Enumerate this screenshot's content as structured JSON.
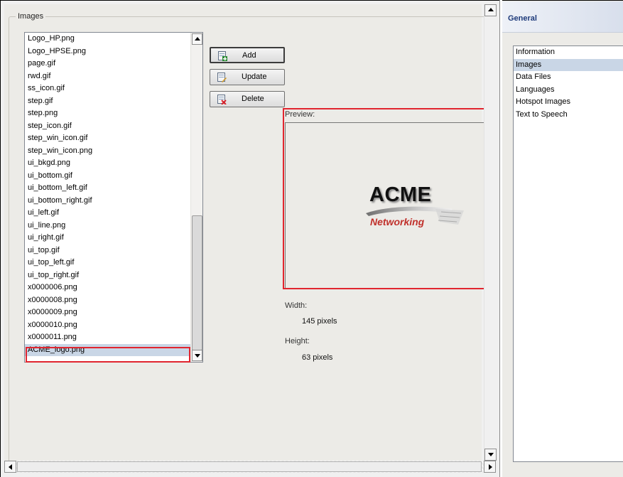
{
  "colors": {
    "selection": "#c9d6e6",
    "highlight_box": "#e1252f",
    "panel_title": "#1d3a7a",
    "logo_red": "#c0302b"
  },
  "images_group": {
    "label": "Images",
    "items": [
      "Logo_HP.png",
      "Logo_HPSE.png",
      "page.gif",
      "rwd.gif",
      "ss_icon.gif",
      "step.gif",
      "step.png",
      "step_icon.gif",
      "step_win_icon.gif",
      "step_win_icon.png",
      "ui_bkgd.png",
      "ui_bottom.gif",
      "ui_bottom_left.gif",
      "ui_bottom_right.gif",
      "ui_left.gif",
      "ui_line.png",
      "ui_right.gif",
      "ui_top.gif",
      "ui_top_left.gif",
      "ui_top_right.gif",
      "x0000006.png",
      "x0000008.png",
      "x0000009.png",
      "x0000010.png",
      "x0000011.png",
      "ACME_logo.png"
    ],
    "selected_item": "ACME_logo.png"
  },
  "buttons": {
    "add": {
      "label": "Add",
      "icon": "add-image-icon"
    },
    "update": {
      "label": "Update",
      "icon": "update-image-icon"
    },
    "delete": {
      "label": "Delete",
      "icon": "delete-image-icon"
    }
  },
  "preview": {
    "label": "Preview:",
    "logo_line1": "ACME",
    "logo_line2": "Networking"
  },
  "dimensions": {
    "width_label": "Width:",
    "width_value": "145 pixels",
    "height_label": "Height:",
    "height_value": "63 pixels"
  },
  "right_panel": {
    "title": "General",
    "categories": [
      "Information",
      "Images",
      "Data Files",
      "Languages",
      "Hotspot Images",
      "Text to Speech"
    ],
    "selected_category": "Images"
  }
}
